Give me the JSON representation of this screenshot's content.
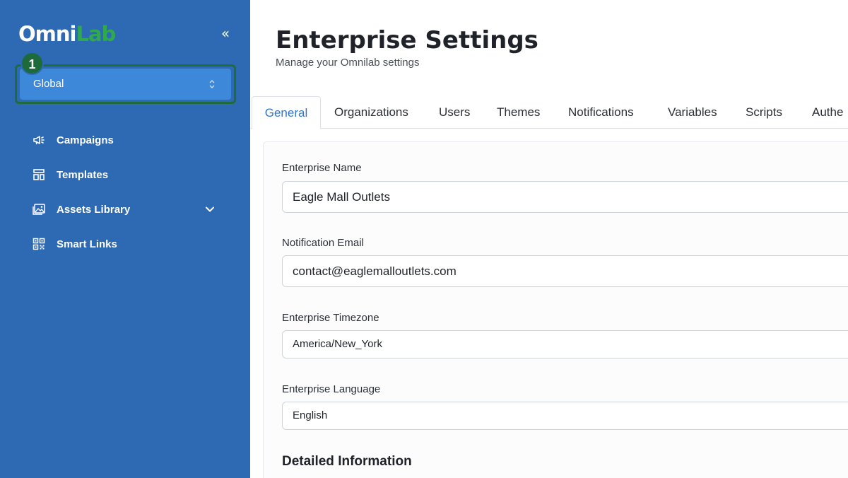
{
  "sidebar": {
    "logo": {
      "part1": "Omni",
      "part2": "Lab"
    },
    "scope_selector": {
      "value": "Global",
      "step_badge": "1"
    },
    "items": [
      {
        "label": "Campaigns",
        "icon": "megaphone-icon"
      },
      {
        "label": "Templates",
        "icon": "template-icon"
      },
      {
        "label": "Assets Library",
        "icon": "image-library-icon",
        "expandable": true
      },
      {
        "label": "Smart Links",
        "icon": "qr-code-icon"
      }
    ]
  },
  "header": {
    "title": "Enterprise Settings",
    "subtitle": "Manage your Omnilab settings"
  },
  "tabs": [
    {
      "label": "General",
      "active": true
    },
    {
      "label": "Organizations"
    },
    {
      "label": "Users"
    },
    {
      "label": "Themes"
    },
    {
      "label": "Notifications"
    },
    {
      "label": "Variables"
    },
    {
      "label": "Scripts"
    },
    {
      "label": "Authe"
    }
  ],
  "form": {
    "enterprise_name": {
      "label": "Enterprise Name",
      "value": "Eagle Mall Outlets"
    },
    "notification_email": {
      "label": "Notification Email",
      "value": "contact@eaglemalloutlets.com"
    },
    "timezone": {
      "label": "Enterprise Timezone",
      "value": "America/New_York"
    },
    "language": {
      "label": "Enterprise Language",
      "value": "English"
    },
    "section_title": "Detailed Information"
  },
  "colors": {
    "sidebar_bg": "#2d6ab3",
    "selector_bg": "#3d88d8",
    "badge_green": "#1d6a3a",
    "logo_green": "#2fa84f",
    "active_tab": "#3277c5"
  }
}
